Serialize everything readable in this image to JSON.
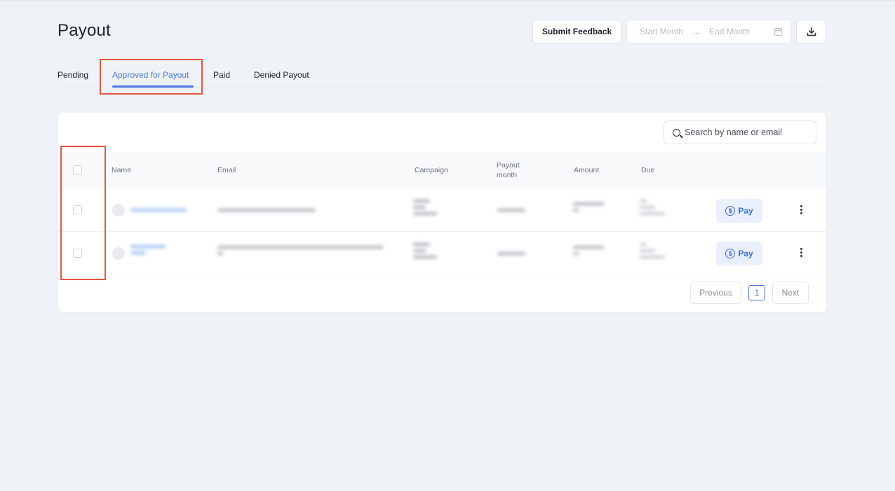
{
  "page": {
    "title": "Payout"
  },
  "header": {
    "feedback_label": "Submit Feedback",
    "date_range": {
      "start_placeholder": "Start Month",
      "arrow": "→",
      "end_placeholder": "End Month"
    }
  },
  "tabs": [
    {
      "label": "Pending"
    },
    {
      "label": "Approved for Payout",
      "active": true
    },
    {
      "label": "Paid"
    },
    {
      "label": "Denied Payout"
    }
  ],
  "search": {
    "placeholder": "Search by name or email"
  },
  "table": {
    "columns": {
      "name": "Name",
      "email": "Email",
      "campaign": "Campaign",
      "payout_month_line1": "Payout",
      "payout_month_line2": "month",
      "amount": "Amount",
      "due": "Due"
    },
    "row_action_label": "Pay",
    "rows_note": "row contents are blurred/redacted in the screenshot"
  },
  "pagination": {
    "previous": "Previous",
    "page": "1",
    "next": "Next"
  },
  "colors": {
    "accent": "#4b78e6",
    "annotation": "#e8553e",
    "background": "#eff2f6"
  },
  "icons": [
    "calendar-icon",
    "download-icon",
    "search-icon",
    "dollar-icon",
    "more-vertical-icon"
  ]
}
